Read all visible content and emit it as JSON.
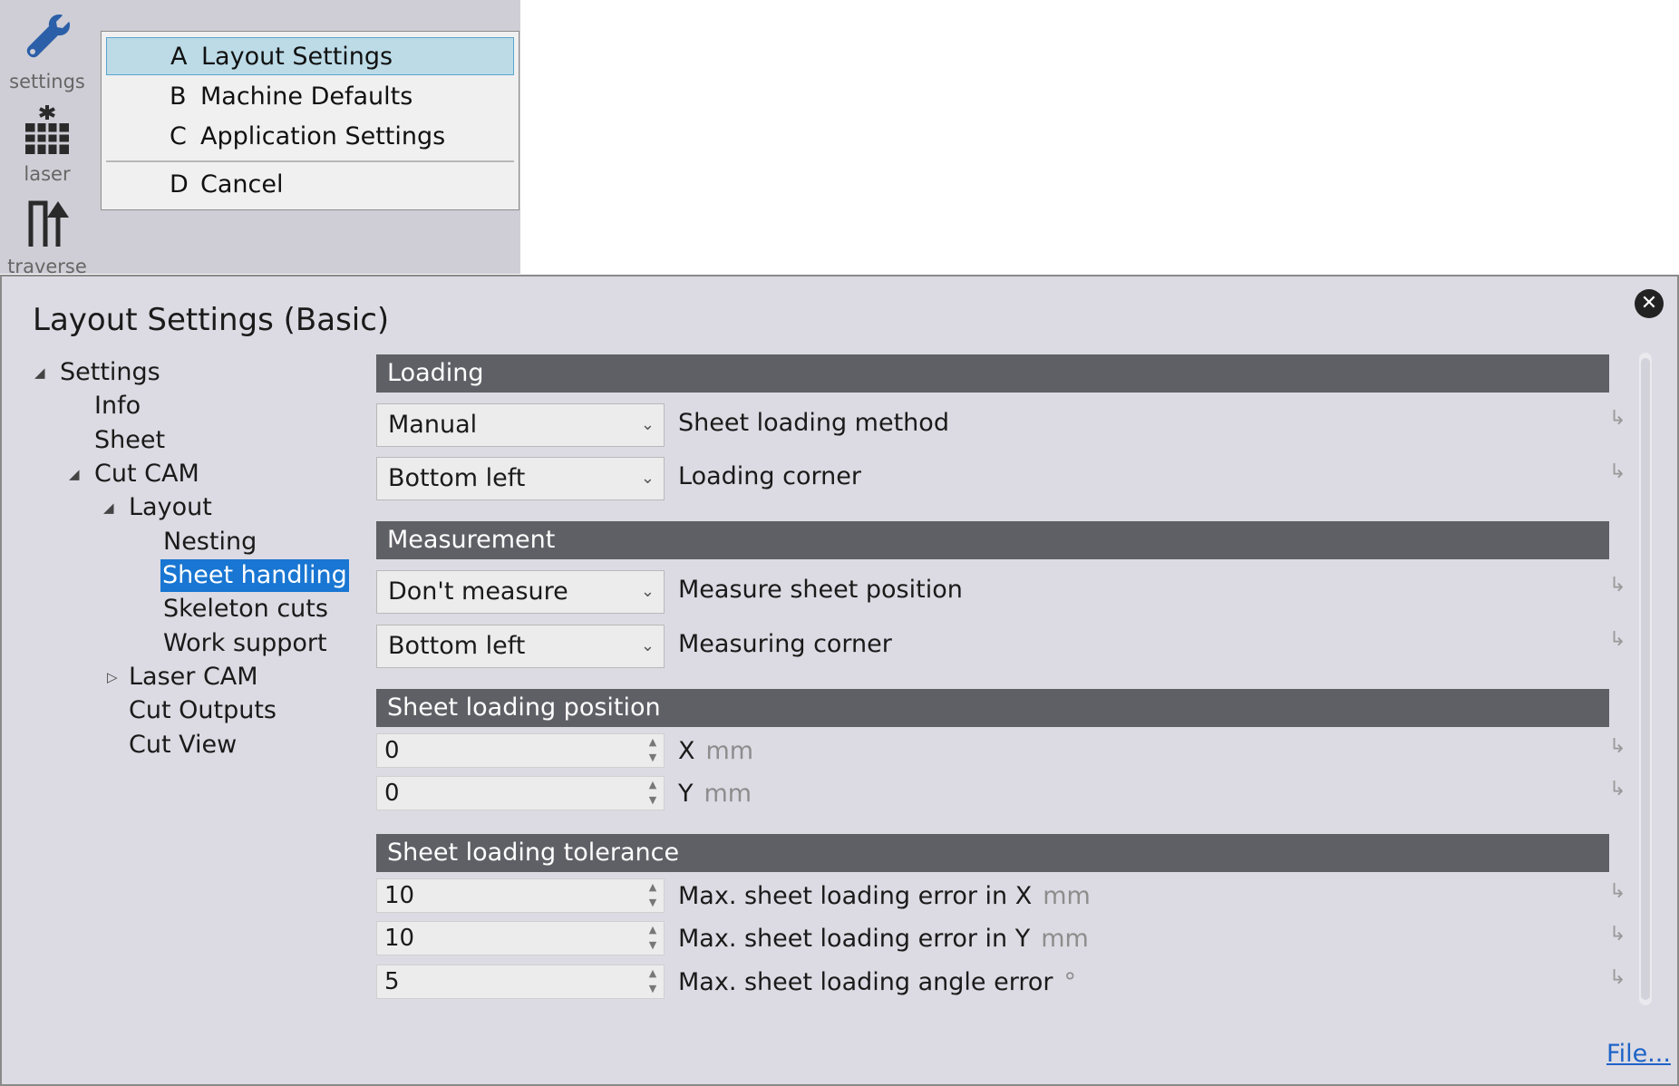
{
  "toolbar": {
    "tools": [
      {
        "label": "settings",
        "icon": "wrench-icon"
      },
      {
        "label": "laser",
        "icon": "laser-icon"
      },
      {
        "label": "traverse",
        "icon": "traverse-icon"
      }
    ]
  },
  "menu": {
    "items": [
      {
        "key": "A",
        "label": "Layout Settings",
        "selected": true
      },
      {
        "key": "B",
        "label": "Machine Defaults"
      },
      {
        "key": "C",
        "label": "Application Settings"
      },
      {
        "key": "D",
        "label": "Cancel"
      }
    ]
  },
  "dialog": {
    "title": "Layout Settings (Basic)",
    "close_icon": "close-icon",
    "tree": [
      {
        "label": "Settings",
        "expanded": true
      },
      {
        "label": "Info"
      },
      {
        "label": "Sheet"
      },
      {
        "label": "Cut CAM",
        "expanded": true
      },
      {
        "label": "Layout",
        "expanded": true
      },
      {
        "label": "Nesting"
      },
      {
        "label": "Sheet handling",
        "selected": true
      },
      {
        "label": "Skeleton cuts"
      },
      {
        "label": "Work support"
      },
      {
        "label": "Laser CAM",
        "expanded": false
      },
      {
        "label": "Cut Outputs"
      },
      {
        "label": "Cut View"
      }
    ],
    "sections": {
      "loading": {
        "header": "Loading",
        "method_value": "Manual",
        "method_label": "Sheet loading method",
        "corner_value": "Bottom left",
        "corner_label": "Loading corner"
      },
      "measurement": {
        "header": "Measurement",
        "measure_value": "Don't measure",
        "measure_label": "Measure sheet position",
        "corner_value": "Bottom left",
        "corner_label": "Measuring corner"
      },
      "position": {
        "header": "Sheet loading position",
        "x_value": "0",
        "x_label": "X",
        "x_unit": "mm",
        "y_value": "0",
        "y_label": "Y",
        "y_unit": "mm"
      },
      "tolerance": {
        "header": "Sheet loading tolerance",
        "err_x_value": "10",
        "err_x_label": "Max. sheet loading error in X",
        "err_x_unit": "mm",
        "err_y_value": "10",
        "err_y_label": "Max. sheet loading error in Y",
        "err_y_unit": "mm",
        "angle_value": "5",
        "angle_label": "Max. sheet loading angle error",
        "angle_unit": "°"
      }
    },
    "file_link": "File..."
  },
  "colors": {
    "toolbar_bg": "#cfced6",
    "dialog_bg": "#dcdbe3",
    "section_header_bg": "#5f5f66",
    "tree_selected_bg": "#1976d2",
    "menu_highlight": "#bcdbe7",
    "link": "#1e63c7"
  }
}
